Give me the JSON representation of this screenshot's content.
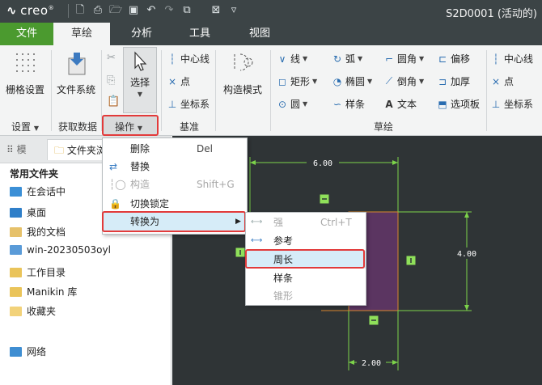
{
  "titlebar": {
    "logo": "creo",
    "window_title": "S2D0001 (活动的)"
  },
  "tabs": [
    "文件",
    "草绘",
    "分析",
    "工具",
    "视图"
  ],
  "ribbon": {
    "grid_settings": "栅格设置",
    "file_system": "文件系统",
    "select": "选择",
    "operations": "操作",
    "centerline": "中心线",
    "point": "点",
    "coord_sys": "坐标系",
    "construct_mode": "构造模式",
    "line": "线",
    "arc": "弧",
    "fillet": "圆角",
    "offset": "偏移",
    "rectangle": "矩形",
    "ellipse": "椭圆",
    "chamfer": "倒角",
    "thicken": "加厚",
    "circle": "圆",
    "spline": "样条",
    "text": "文本",
    "palette": "选项板",
    "centerline2": "中心线",
    "point2": "点",
    "coord_sys2": "坐标系",
    "groups": {
      "settings": "设置",
      "get_data": "获取数据",
      "datum": "基准",
      "sketch": "草绘"
    }
  },
  "leftpanel": {
    "tab1": "模",
    "tab2": "文件夹浏",
    "heading": "常用文件夹",
    "items": [
      "在会话中",
      "桌面",
      "我的文档",
      "win-20230503oyl",
      "工作目录",
      "Manikin 库",
      "收藏夹",
      "网络"
    ]
  },
  "operations_menu": {
    "items": [
      {
        "label": "删除",
        "shortcut": "Del"
      },
      {
        "label": "替换",
        "shortcut": ""
      },
      {
        "label": "构造",
        "shortcut": "Shift+G"
      },
      {
        "label": "切换锁定",
        "shortcut": ""
      },
      {
        "label": "转换为",
        "shortcut": ""
      }
    ]
  },
  "convert_menu": {
    "items": [
      {
        "label": "强",
        "shortcut": "Ctrl+T"
      },
      {
        "label": "参考",
        "shortcut": ""
      },
      {
        "label": "周长",
        "shortcut": ""
      },
      {
        "label": "样条",
        "shortcut": ""
      },
      {
        "label": "锥形",
        "shortcut": ""
      }
    ]
  },
  "dimensions": {
    "width_top": "6.00",
    "height_right": "4.00",
    "width_bottom": "2.00"
  },
  "colors": {
    "titlebar": "#3c4446",
    "file_tab": "#4b9a2f",
    "canvas": "#2f3436",
    "highlight": "#d6ecf8",
    "callout": "#e23a3a",
    "dim_green": "#7cd34a",
    "shape_fill": "#5b3561",
    "shape_edge": "#d9862e"
  }
}
